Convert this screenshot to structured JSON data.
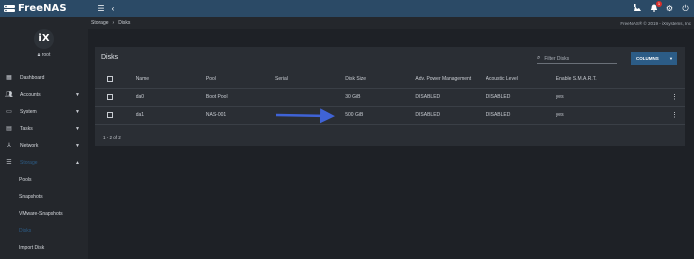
{
  "topbar": {
    "app_name": "FreeNAS",
    "menu_icon": "hamburger-icon",
    "back_icon": "chevron-left-icon",
    "notification_count": "1"
  },
  "sidebar": {
    "user": "root",
    "items": [
      {
        "label": "Dashboard",
        "icon": "dashboard-icon",
        "caret": ""
      },
      {
        "label": "Accounts",
        "icon": "accounts-icon",
        "caret": "▼"
      },
      {
        "label": "System",
        "icon": "system-icon",
        "caret": "▼"
      },
      {
        "label": "Tasks",
        "icon": "calendar-icon",
        "caret": "▼"
      },
      {
        "label": "Network",
        "icon": "network-icon",
        "caret": "▼"
      },
      {
        "label": "Storage",
        "icon": "storage-icon",
        "caret": "▲"
      }
    ],
    "sub_items": [
      "Pools",
      "Snapshots",
      "VMware-Snapshots",
      "Disks",
      "Import Disk"
    ]
  },
  "breadcrumb": {
    "parent": "Storage",
    "current": "Disks",
    "copyright": "FreeNAS® © 2019 - iXsystems, Inc"
  },
  "card": {
    "title": "Disks",
    "filter_placeholder": "Filter Disks",
    "columns_label": "COLUMNS"
  },
  "table": {
    "headers": [
      "Name",
      "Pool",
      "Serial",
      "Disk Size",
      "Adv. Power Management",
      "Acoustic Level",
      "Enable S.M.A.R.T."
    ],
    "rows": [
      {
        "name": "da0",
        "pool": "Boot Pool",
        "serial": "",
        "size": "30 GiB",
        "apm": "DISABLED",
        "acoustic": "DISABLED",
        "smart": "yes"
      },
      {
        "name": "da1",
        "pool": "NAS-001",
        "serial": "",
        "size": "500 GiB",
        "apm": "DISABLED",
        "acoustic": "DISABLED",
        "smart": "yes"
      }
    ],
    "pager": "1 - 2 of 2"
  },
  "colors": {
    "topbar": "#2b4a66",
    "accent": "#2c5c86",
    "arrow": "#3f63d6",
    "background": "#1e2126"
  }
}
